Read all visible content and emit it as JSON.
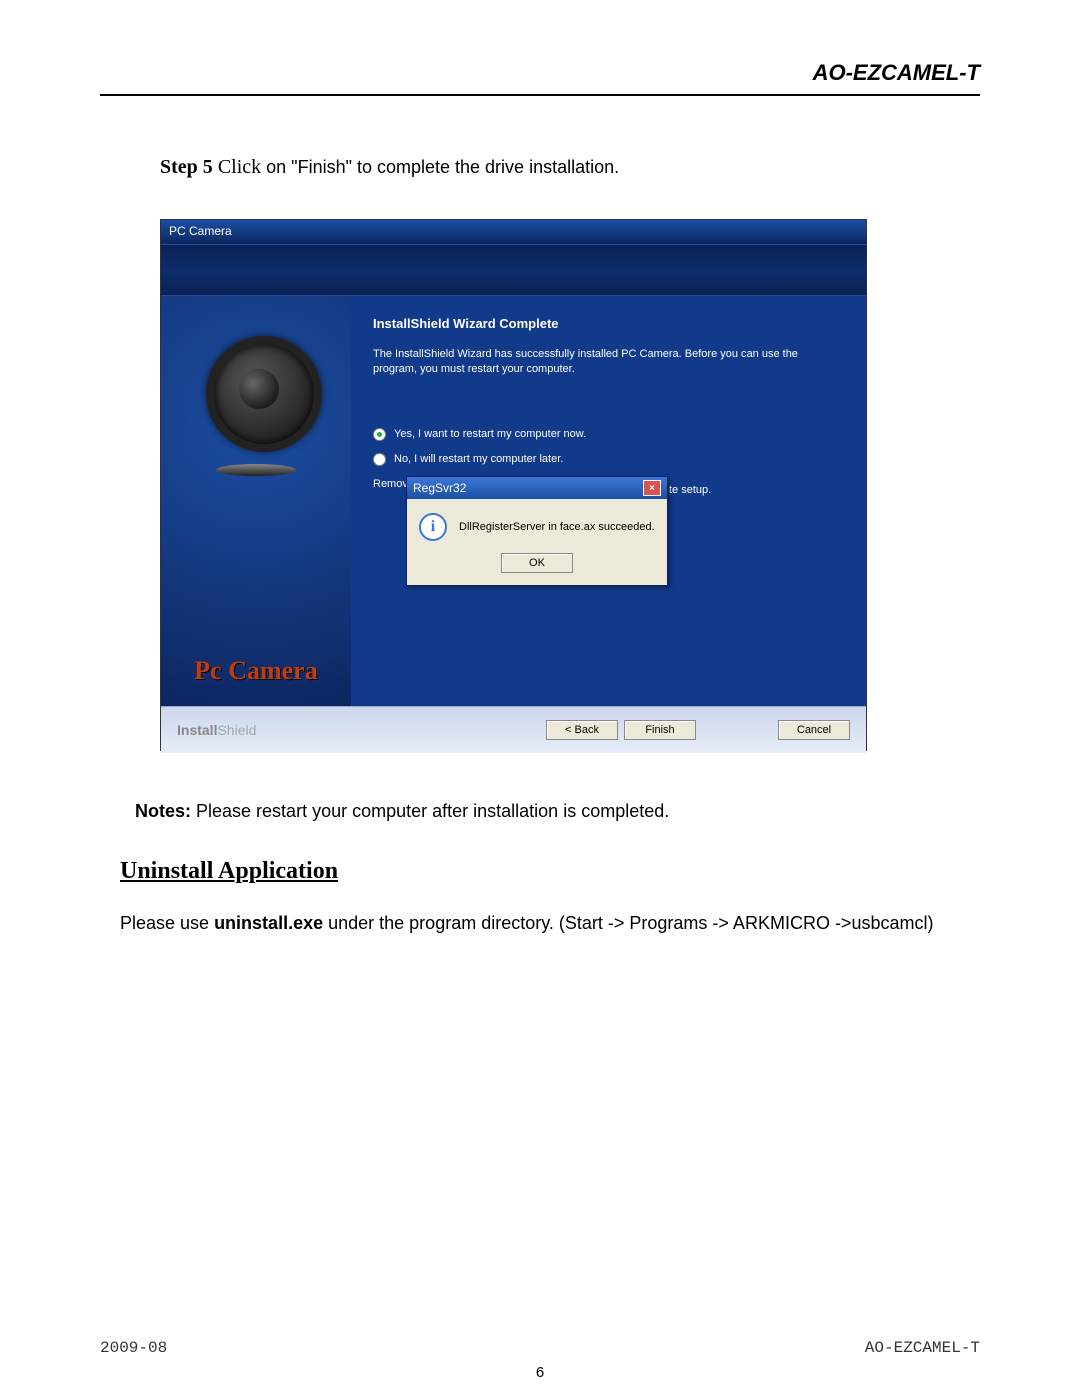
{
  "header": {
    "title": "AO-EZCAMEL-T"
  },
  "step": {
    "label": "Step 5",
    "verb": "Click",
    "rest": " on \"Finish\" to complete the drive installation."
  },
  "installer": {
    "window_title": "PC Camera",
    "side_label": "Pc Camera",
    "heading": "InstallShield Wizard Complete",
    "desc": "The InstallShield Wizard has successfully installed PC Camera.  Before you can use the program, you must restart your computer.",
    "radio_yes": "Yes, I want to restart my computer now.",
    "radio_no": "No, I will restart my computer later.",
    "remove_prefix": "Remove a",
    "te_setup_suffix": "te setup.",
    "popup": {
      "title": "RegSvr32",
      "message": "DllRegisterServer in face.ax succeeded.",
      "ok": "OK"
    },
    "brand_a": "Install",
    "brand_b": "Shield",
    "btn_back": "< Back",
    "btn_finish": "Finish",
    "btn_cancel": "Cancel"
  },
  "notes": {
    "label": "Notes:",
    "text": " Please restart your computer after installation is completed."
  },
  "uninstall": {
    "heading": "Uninstall Application",
    "pre": "Please use ",
    "exe": "uninstall.exe",
    "post": " under the program directory. (Start -> Programs -> ARKMICRO ->usbcamcl)"
  },
  "footer": {
    "left": "2009-08",
    "right": "AO-EZCAMEL-T",
    "page": "6"
  }
}
